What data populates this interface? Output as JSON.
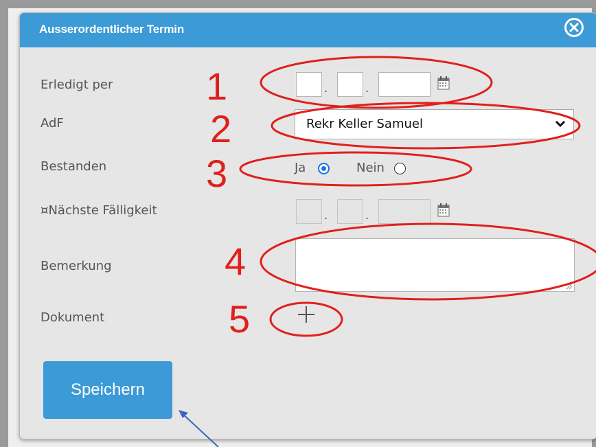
{
  "dialog": {
    "title": "Ausserordentlicher Termin"
  },
  "fields": {
    "erledigt_label": "Erledigt per",
    "adf_label": "AdF",
    "adf_selected": "Rekr Keller Samuel",
    "bestanden_label": "Bestanden",
    "ja_label": "Ja",
    "nein_label": "Nein",
    "bestanden_value": "Ja",
    "naechste_label": "¤Nächste Fälligkeit",
    "bemerkung_label": "Bemerkung",
    "dokument_label": "Dokument"
  },
  "buttons": {
    "save_label": "Speichern"
  },
  "annotations": {
    "numbers": [
      "1",
      "2",
      "3",
      "4",
      "5"
    ],
    "color": "#e0201c"
  },
  "colors": {
    "accent": "#3c9ad6",
    "radio_selected": "#1a73e8"
  },
  "icons": {
    "close": "close-circle-icon",
    "calendar": "calendar-icon",
    "chevron": "chevron-down-icon",
    "add": "plus-icon"
  }
}
